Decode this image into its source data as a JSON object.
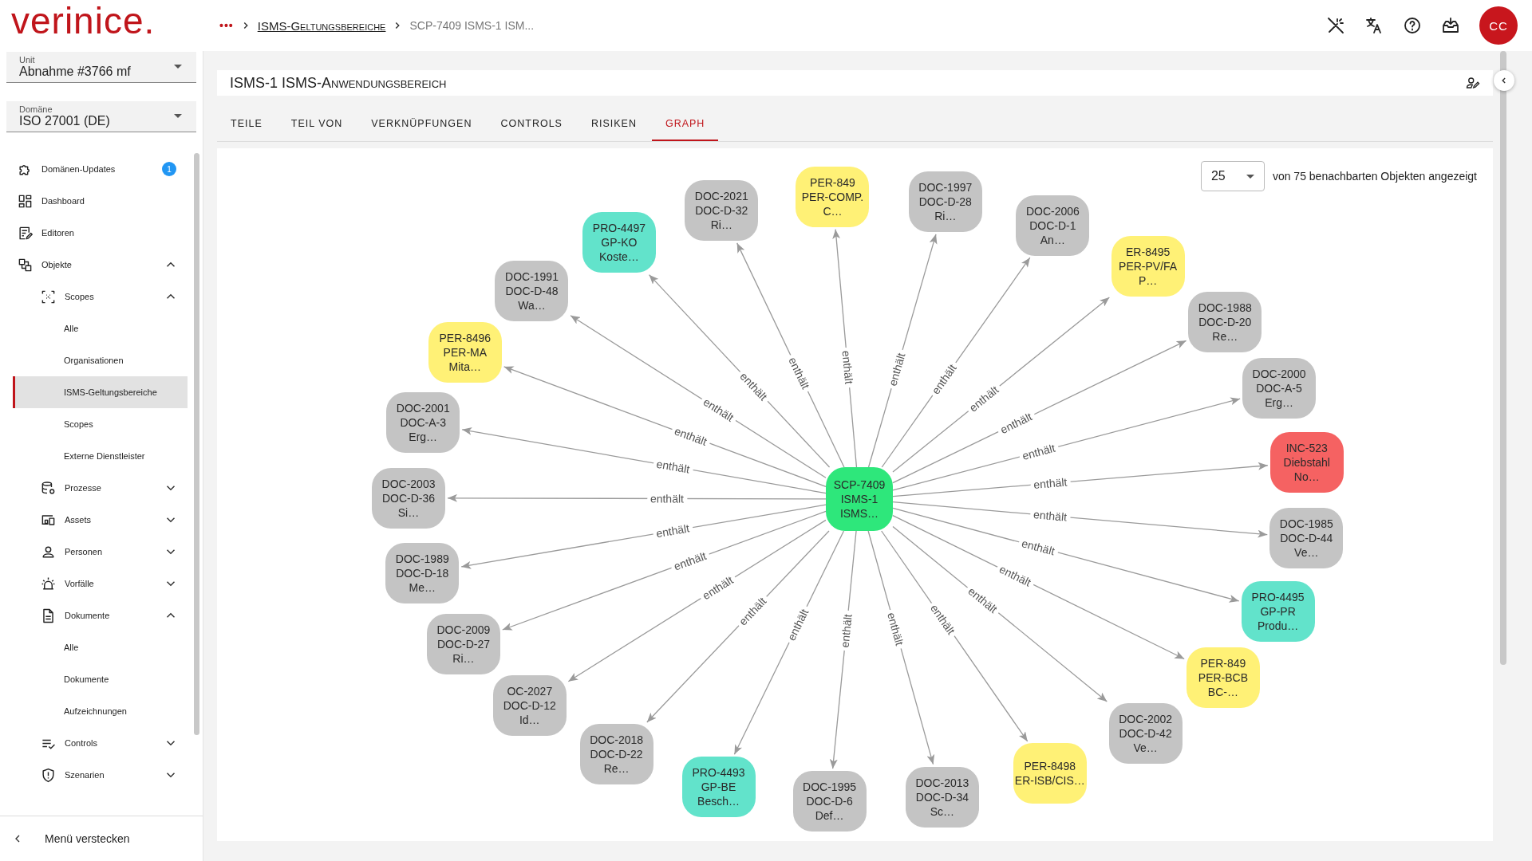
{
  "header": {
    "logo": "verinice.",
    "breadcrumb": [
      {
        "text": "•••",
        "kind": "menu"
      },
      {
        "text": "ISMS-Geltungsbereiche",
        "kind": "link"
      },
      {
        "text": "SCP-7409 ISMS-1 ISM...",
        "kind": "current"
      }
    ],
    "avatar": "CC"
  },
  "sidebar": {
    "unit": {
      "label": "Unit",
      "value": "Abnahme #3766 mf"
    },
    "domain": {
      "label": "Domäne",
      "value": "ISO 27001 (DE)"
    },
    "items": [
      {
        "label": "Domänen-Updates",
        "badge": "1",
        "selected": false
      },
      {
        "label": "Dashboard",
        "selected": false
      },
      {
        "label": "Editoren",
        "selected": false
      },
      {
        "label": "Objekte",
        "expanded": true,
        "children": [
          {
            "label": "Scopes",
            "expanded": true,
            "children": [
              {
                "label": "Alle",
                "selected": false
              },
              {
                "label": "Organisationen",
                "selected": false
              },
              {
                "label": "ISMS-Geltungsbereiche",
                "selected": true
              },
              {
                "label": "Scopes",
                "selected": false
              },
              {
                "label": "Externe Dienstleister",
                "selected": false
              }
            ]
          },
          {
            "label": "Prozesse",
            "expanded": false
          },
          {
            "label": "Assets",
            "expanded": false
          },
          {
            "label": "Personen",
            "expanded": false
          },
          {
            "label": "Vorfälle",
            "expanded": false
          },
          {
            "label": "Dokumente",
            "expanded": true,
            "children": [
              {
                "label": "Alle",
                "selected": false
              },
              {
                "label": "Dokumente",
                "selected": false
              },
              {
                "label": "Aufzeichnungen",
                "selected": false
              }
            ]
          },
          {
            "label": "Controls",
            "expanded": false
          },
          {
            "label": "Szenarien",
            "expanded": false
          }
        ]
      }
    ],
    "hide_menu": "Menü verstecken"
  },
  "page": {
    "title": "ISMS-1 ISMS-Anwendungsbereich",
    "tabs": [
      {
        "label": "TEILE",
        "selected": false
      },
      {
        "label": "TEIL VON",
        "selected": false
      },
      {
        "label": "VERKNÜPFUNGEN",
        "selected": false
      },
      {
        "label": "CONTROLS",
        "selected": false
      },
      {
        "label": "RISIKEN",
        "selected": false
      },
      {
        "label": "GRAPH",
        "selected": true
      }
    ],
    "graph": {
      "limit": "25",
      "limit_note": "von 75 benachbarten Objekten angezeigt",
      "center": {
        "lines": [
          "SCP-7409",
          "ISMS-1",
          "ISMS…"
        ],
        "color": "#2ee77b"
      },
      "nodes": [
        {
          "lines": [
            "DOC-2021",
            "DOC-D-32",
            "Ri…"
          ],
          "color": "#c4c4c4",
          "edge_label": "enthält"
        },
        {
          "lines": [
            "PER-849",
            "PER-COMP.",
            "C…"
          ],
          "color": "#fff176",
          "edge_label": "enthält"
        },
        {
          "lines": [
            "DOC-1997",
            "DOC-D-28",
            "Ri…"
          ],
          "color": "#c4c4c4",
          "edge_label": "enthält"
        },
        {
          "lines": [
            "DOC-2006",
            "DOC-D-1",
            "An…"
          ],
          "color": "#c4c4c4",
          "edge_label": "enthält"
        },
        {
          "lines": [
            "ER-8495",
            "PER-PV/FA",
            "P…"
          ],
          "color": "#fff176",
          "edge_label": "enthält"
        },
        {
          "lines": [
            "DOC-1988",
            "DOC-D-20",
            "Re…"
          ],
          "color": "#c4c4c4",
          "edge_label": "enthält"
        },
        {
          "lines": [
            "DOC-2000",
            "DOC-A-5",
            "Erg…"
          ],
          "color": "#c4c4c4",
          "edge_label": "enthält"
        },
        {
          "lines": [
            "INC-523",
            "Diebstahl",
            "No…"
          ],
          "color": "#f56262",
          "edge_label": "enthält"
        },
        {
          "lines": [
            "DOC-1985",
            "DOC-D-44",
            "Ve…"
          ],
          "color": "#c4c4c4",
          "edge_label": "enthält"
        },
        {
          "lines": [
            "PRO-4495",
            "GP-PR",
            "Produ…"
          ],
          "color": "#62e3cb",
          "edge_label": "enthält"
        },
        {
          "lines": [
            "PER-849",
            "PER-BCB",
            "BC-…"
          ],
          "color": "#fff176",
          "edge_label": "enthält"
        },
        {
          "lines": [
            "DOC-2002",
            "DOC-D-42",
            "Ve…"
          ],
          "color": "#c4c4c4",
          "edge_label": "enthält"
        },
        {
          "lines": [
            "PER-8498",
            "ER-ISB/CIS…"
          ],
          "color": "#fff176",
          "edge_label": "enthält"
        },
        {
          "lines": [
            "DOC-2013",
            "DOC-D-34",
            "Sc…"
          ],
          "color": "#c4c4c4",
          "edge_label": "enthält"
        },
        {
          "lines": [
            "DOC-1995",
            "DOC-D-6",
            "Def…"
          ],
          "color": "#c4c4c4",
          "edge_label": "enthält"
        },
        {
          "lines": [
            "PRO-4493",
            "GP-BE",
            "Besch…"
          ],
          "color": "#62e3cb",
          "edge_label": "enthält"
        },
        {
          "lines": [
            "DOC-2018",
            "DOC-D-22",
            "Re…"
          ],
          "color": "#c4c4c4",
          "edge_label": "enthält"
        },
        {
          "lines": [
            "OC-2027",
            "DOC-D-12",
            "Id…"
          ],
          "color": "#c4c4c4",
          "edge_label": "enthält"
        },
        {
          "lines": [
            "DOC-2009",
            "DOC-D-27",
            "Ri…"
          ],
          "color": "#c4c4c4",
          "edge_label": "enthält"
        },
        {
          "lines": [
            "DOC-1989",
            "DOC-D-18",
            "Me…"
          ],
          "color": "#c4c4c4",
          "edge_label": "enthält"
        },
        {
          "lines": [
            "DOC-2003",
            "DOC-D-36",
            "Si…"
          ],
          "color": "#c4c4c4",
          "edge_label": "enthält"
        },
        {
          "lines": [
            "DOC-2001",
            "DOC-A-3",
            "Erg…"
          ],
          "color": "#c4c4c4",
          "edge_label": "enthält"
        },
        {
          "lines": [
            "PER-8496",
            "PER-MA",
            "Mita…"
          ],
          "color": "#fff176",
          "edge_label": "enthält"
        },
        {
          "lines": [
            "DOC-1991",
            "DOC-D-48",
            "Wa…"
          ],
          "color": "#c4c4c4",
          "edge_label": "enthält"
        },
        {
          "lines": [
            "PRO-4497",
            "GP-KO",
            "Koste…"
          ],
          "color": "#62e3cb",
          "edge_label": "enthält"
        }
      ]
    }
  }
}
